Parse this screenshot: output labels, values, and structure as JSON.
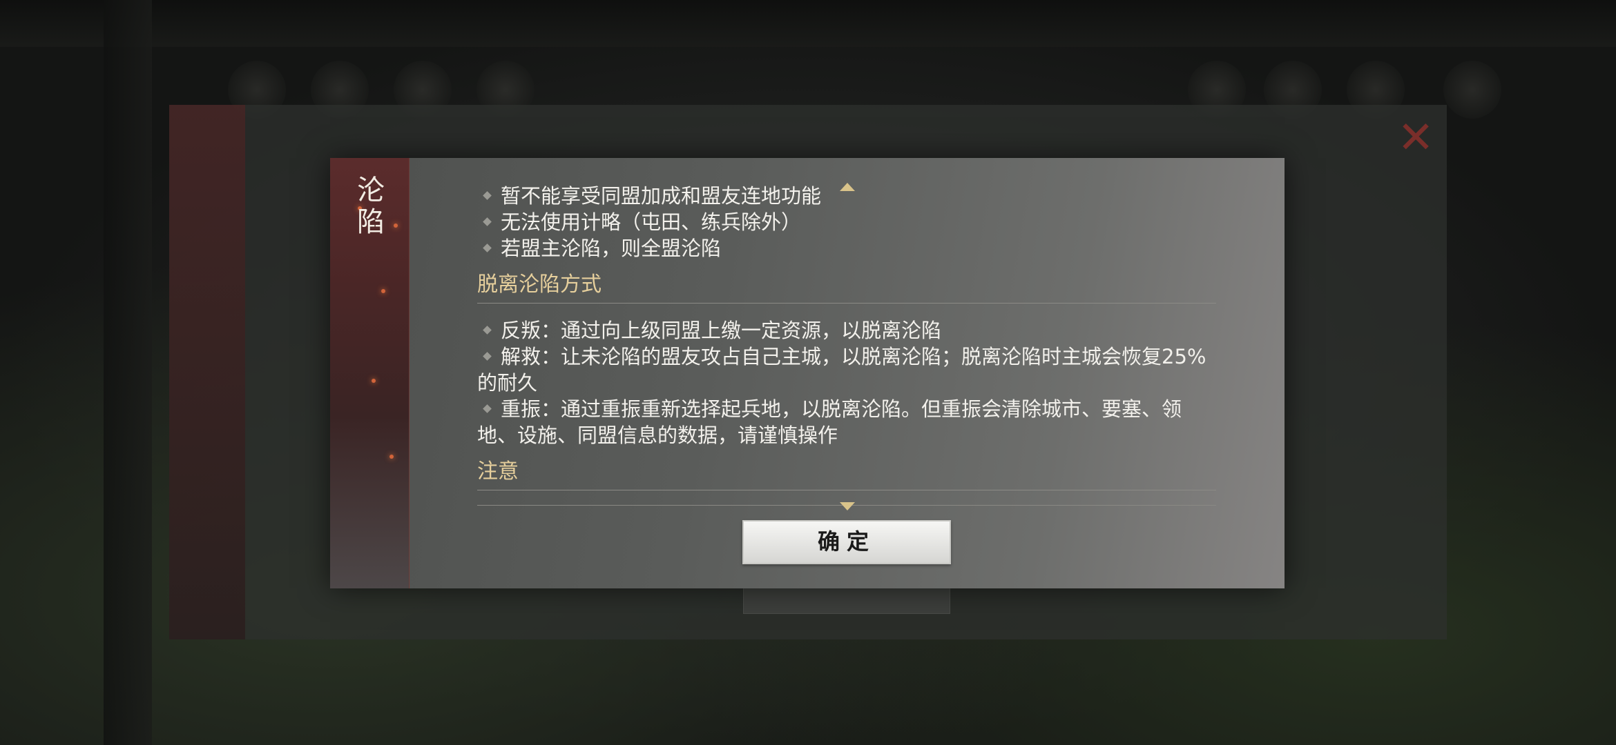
{
  "dialog": {
    "title": "沦陷",
    "effects": [
      "暂不能享受同盟加成和盟友连地功能",
      "无法使用计略（屯田、练兵除外）",
      "若盟主沦陷，则全盟沦陷"
    ],
    "escape_section_title": "脱离沦陷方式",
    "escape_methods": [
      "反叛：通过向上级同盟上缴一定资源，以脱离沦陷",
      "解救：让未沦陷的盟友攻占自己主城，以脱离沦陷；脱离沦陷时主城会恢复25%的耐久",
      "重振：通过重振重新选择起兵地，以脱离沦陷。但重振会清除城市、要塞、领地、设施、同盟信息的数据，请谨慎操作"
    ],
    "notice_section_title": "注意",
    "confirm_label": "确定"
  },
  "colors": {
    "section_title": "#e6cf9c",
    "scroll_arrow": "#d9c38a",
    "side_banner": "#5b2c2c"
  }
}
